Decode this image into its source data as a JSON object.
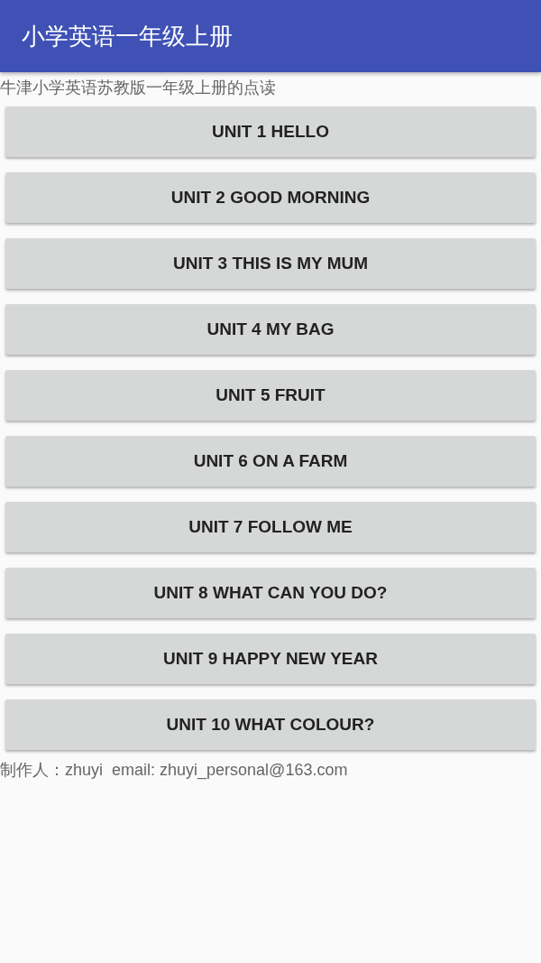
{
  "app_bar": {
    "title": "小学英语一年级上册"
  },
  "subtitle": "牛津小学英语苏教版一年级上册的点读",
  "units": [
    {
      "label": "UNIT 1 HELLO"
    },
    {
      "label": "UNIT 2 GOOD MORNING"
    },
    {
      "label": "UNIT 3 THIS IS MY MUM"
    },
    {
      "label": "UNIT 4 MY BAG"
    },
    {
      "label": "UNIT 5 FRUIT"
    },
    {
      "label": "UNIT 6 ON A FARM"
    },
    {
      "label": "UNIT 7 FOLLOW ME"
    },
    {
      "label": "UNIT 8 WHAT CAN YOU DO?"
    },
    {
      "label": "UNIT 9 HAPPY NEW YEAR"
    },
    {
      "label": "UNIT 10 WHAT COLOUR?"
    }
  ],
  "footer": "制作人：zhuyi  email: zhuyi_personal@163.com"
}
